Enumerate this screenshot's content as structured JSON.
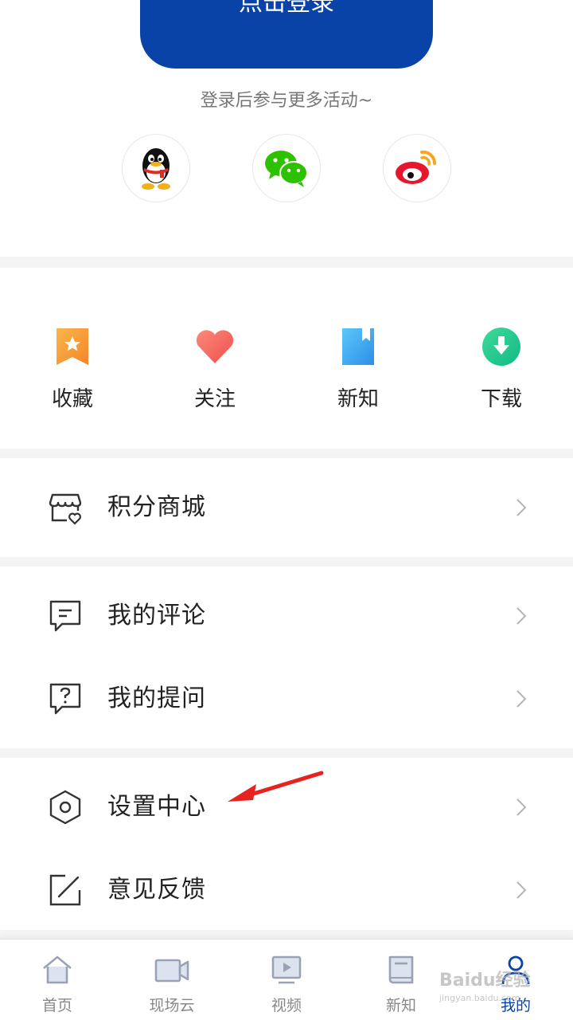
{
  "login": {
    "button_label": "点击登录",
    "hint": "登录后参与更多活动~",
    "social": [
      {
        "name": "qq",
        "icon": "qq-penguin-icon"
      },
      {
        "name": "wechat",
        "icon": "wechat-icon"
      },
      {
        "name": "weibo",
        "icon": "weibo-icon"
      }
    ]
  },
  "quick": [
    {
      "label": "收藏",
      "icon": "favorite-star-bookmark-icon",
      "color": "#f5a03a"
    },
    {
      "label": "关注",
      "icon": "heart-icon",
      "color": "#f4685f"
    },
    {
      "label": "新知",
      "icon": "book-bookmark-icon",
      "color": "#3aa6ef"
    },
    {
      "label": "下载",
      "icon": "download-icon",
      "color": "#22c48a"
    }
  ],
  "menu": {
    "mall": {
      "label": "积分商城",
      "icon": "store-icon"
    },
    "comments": {
      "label": "我的评论",
      "icon": "comment-icon"
    },
    "questions": {
      "label": "我的提问",
      "icon": "question-icon"
    },
    "settings": {
      "label": "设置中心",
      "icon": "settings-hexagon-icon"
    },
    "feedback": {
      "label": "意见反馈",
      "icon": "edit-icon"
    }
  },
  "tabs": [
    {
      "label": "首页",
      "icon": "home-icon",
      "active": false
    },
    {
      "label": "现场云",
      "icon": "video-camera-icon",
      "active": false
    },
    {
      "label": "视频",
      "icon": "video-play-icon",
      "active": false
    },
    {
      "label": "新知",
      "icon": "book-icon",
      "active": false
    },
    {
      "label": "我的",
      "icon": "user-icon",
      "active": true
    }
  ],
  "colors": {
    "brand_blue": "#0a43a8",
    "annotation_red": "#e8231f"
  },
  "watermark": {
    "title": "Baidu经验",
    "subtitle": "jingyan.baidu.com"
  }
}
